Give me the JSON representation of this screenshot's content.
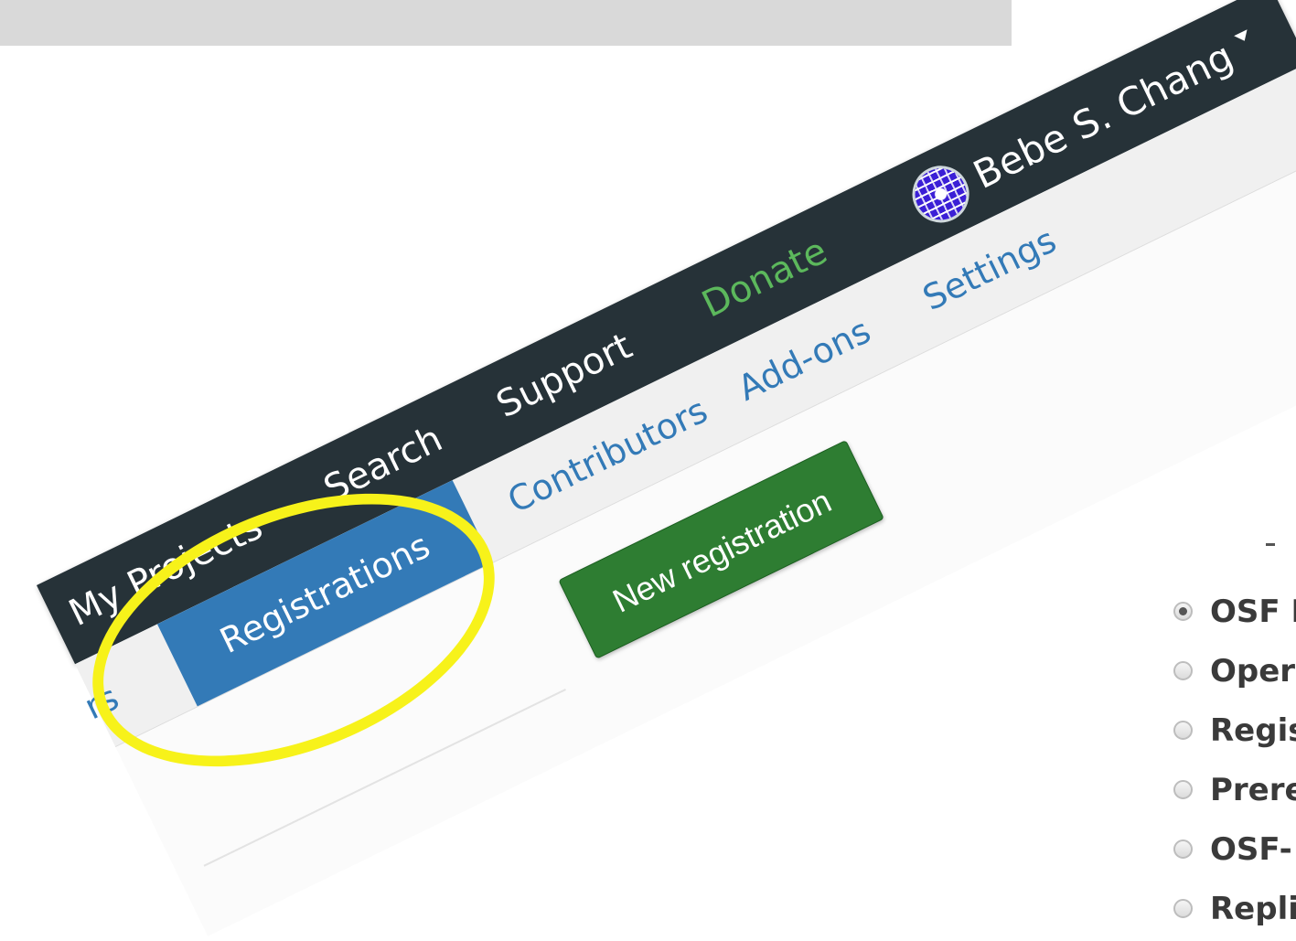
{
  "navbar": {
    "items": [
      {
        "label": "My Projects"
      },
      {
        "label": "Search"
      },
      {
        "label": "Support"
      },
      {
        "label": "Donate"
      }
    ],
    "user": {
      "name": "Bebe S. Chang"
    }
  },
  "subnav": {
    "items": [
      {
        "label": "rs"
      },
      {
        "label": "Registrations",
        "active": true
      },
      {
        "label": "Contributors"
      },
      {
        "label": "Add-ons"
      },
      {
        "label": "Settings"
      }
    ]
  },
  "main": {
    "new_registration_label": "New registration"
  },
  "schema_list": {
    "dash": "-",
    "options": [
      {
        "label": "OSF I",
        "checked": true
      },
      {
        "label": "Oper",
        "checked": false
      },
      {
        "label": "Regis",
        "checked": false
      },
      {
        "label": "Prere",
        "checked": false
      },
      {
        "label": "OSF-",
        "checked": false
      },
      {
        "label": "Repli",
        "checked": false
      }
    ]
  },
  "colors": {
    "navbar_bg": "#263238",
    "donate": "#5cb85c",
    "active_tab": "#337ab7",
    "new_registration_button": "#2e7d32",
    "highlight": "#f7f21a"
  }
}
